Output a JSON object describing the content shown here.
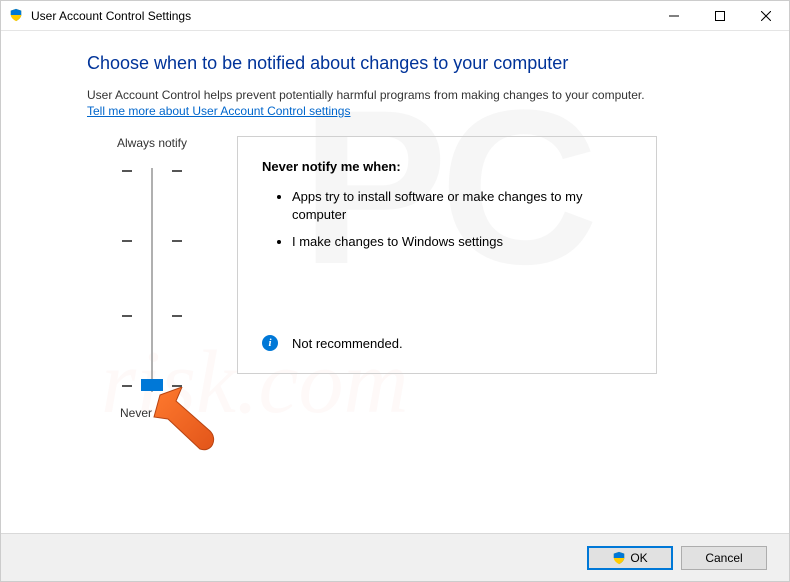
{
  "window": {
    "title": "User Account Control Settings"
  },
  "heading": "Choose when to be notified about changes to your computer",
  "subtext": "User Account Control helps prevent potentially harmful programs from making changes to your computer.",
  "link": "Tell me more about User Account Control settings",
  "slider": {
    "top_label": "Always notify",
    "bottom_label": "Never notify",
    "levels": 4,
    "selected_level": 0
  },
  "description": {
    "title": "Never notify me when:",
    "bullets": [
      "Apps try to install software or make changes to my computer",
      "I make changes to Windows settings"
    ],
    "recommendation": "Not recommended."
  },
  "buttons": {
    "ok": "OK",
    "cancel": "Cancel"
  },
  "icons": {
    "shield": "shield-icon",
    "minimize": "minimize-icon",
    "maximize": "maximize-icon",
    "close": "close-icon",
    "info": "info-icon"
  }
}
